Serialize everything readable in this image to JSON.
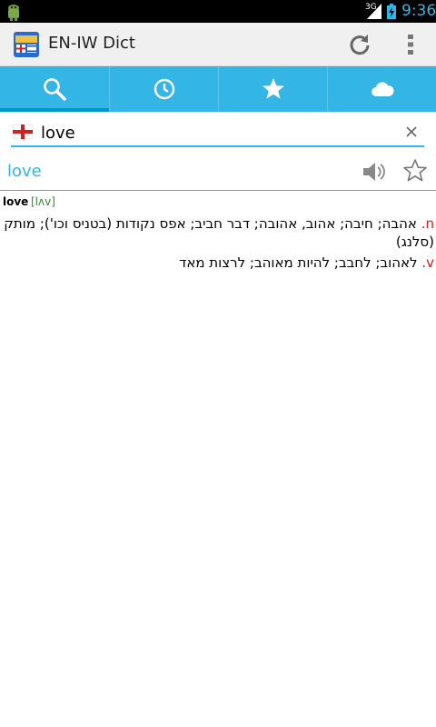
{
  "status_bar": {
    "network_label": "3G",
    "time": "9:36"
  },
  "action_bar": {
    "title": "EN-IW Dict"
  },
  "tabs": [
    {
      "name": "search",
      "icon": "search-icon",
      "selected": true
    },
    {
      "name": "history",
      "icon": "clock-icon",
      "selected": false
    },
    {
      "name": "favorites",
      "icon": "star-icon",
      "selected": false
    },
    {
      "name": "cloud",
      "icon": "cloud-icon",
      "selected": false
    }
  ],
  "search": {
    "value": "love"
  },
  "result": {
    "word": "love",
    "headword": "love",
    "phonetic": "[lʌv]",
    "definitions": [
      {
        "pos": "n.",
        "text": "אהבה; חיבה; אהוב, אהובה; דבר חביב; אפס נקודות (בטניס וכו'); מותק (סלנג)"
      },
      {
        "pos": "v.",
        "text": "לאהוב; לחבב; להיות מאוהב; לרצות מאד"
      }
    ]
  },
  "colors": {
    "accent": "#33b5e5",
    "tab_indicator": "#0099cc",
    "pos_red": "#d02020",
    "phonetic_green": "#2e8b2e"
  }
}
